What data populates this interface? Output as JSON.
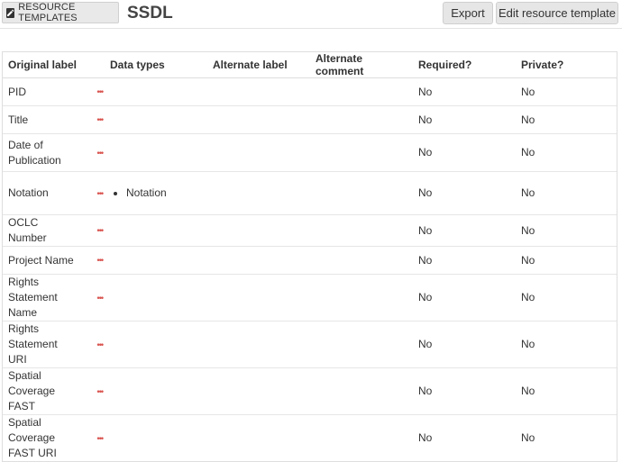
{
  "header": {
    "badge_label": "RESOURCE TEMPLATES",
    "badge_icon": "pencil-square-icon",
    "title": "SSDL",
    "export_label": "Export",
    "edit_label": "Edit resource template"
  },
  "table": {
    "columns": [
      "Original label",
      "Data types",
      "Alternate label",
      "Alternate comment",
      "Required?",
      "Private?"
    ],
    "rows": [
      {
        "label": "PID",
        "data_types": [],
        "alt_label": "",
        "alt_comment": "",
        "required": "No",
        "private": "No"
      },
      {
        "label": "Title",
        "data_types": [],
        "alt_label": "",
        "alt_comment": "",
        "required": "No",
        "private": "No"
      },
      {
        "label": "Date of Publication",
        "data_types": [],
        "alt_label": "",
        "alt_comment": "",
        "required": "No",
        "private": "No"
      },
      {
        "label": "Notation",
        "data_types": [
          "Notation"
        ],
        "alt_label": "",
        "alt_comment": "",
        "required": "No",
        "private": "No"
      },
      {
        "label": "OCLC Number",
        "data_types": [],
        "alt_label": "",
        "alt_comment": "",
        "required": "No",
        "private": "No"
      },
      {
        "label": "Project Name",
        "data_types": [],
        "alt_label": "",
        "alt_comment": "",
        "required": "No",
        "private": "No"
      },
      {
        "label": "Rights Statement Name",
        "data_types": [],
        "alt_label": "",
        "alt_comment": "",
        "required": "No",
        "private": "No"
      },
      {
        "label": "Rights Statement URI",
        "data_types": [],
        "alt_label": "",
        "alt_comment": "",
        "required": "No",
        "private": "No"
      },
      {
        "label": "Spatial Coverage FAST",
        "data_types": [],
        "alt_label": "",
        "alt_comment": "",
        "required": "No",
        "private": "No"
      },
      {
        "label": "Spatial Coverage FAST URI",
        "data_types": [],
        "alt_label": "",
        "alt_comment": "",
        "required": "No",
        "private": "No"
      }
    ],
    "more_glyph": "•••"
  }
}
